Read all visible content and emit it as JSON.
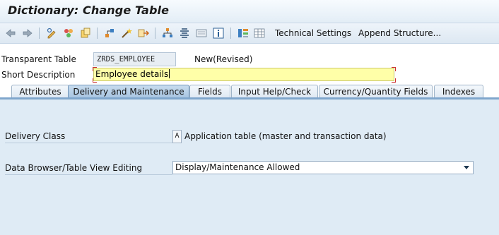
{
  "window": {
    "title": "Dictionary: Change Table"
  },
  "toolbar": {
    "icons": [
      "back-arrow-icon",
      "forward-arrow-icon",
      "display-change-icon",
      "activate-icon",
      "check-icon",
      "where-used-icon",
      "object-list-icon",
      "navigation-icon",
      "hierarchy-icon",
      "list-icon",
      "display-object-icon",
      "info-icon",
      "layout-icon",
      "table-icon"
    ],
    "technical_settings_label": "Technical Settings",
    "append_structure_label": "Append Structure..."
  },
  "header": {
    "transparent_table_label": "Transparent Table",
    "table_name": "ZRDS_EMPLOYEE",
    "status": "New(Revised)",
    "short_description_label": "Short Description",
    "short_description_value": "Employee details"
  },
  "tabs": [
    {
      "label": "Attributes",
      "active": false
    },
    {
      "label": "Delivery and Maintenance",
      "active": true
    },
    {
      "label": "Fields",
      "active": false
    },
    {
      "label": "Input Help/Check",
      "active": false
    },
    {
      "label": "Currency/Quantity Fields",
      "active": false
    },
    {
      "label": "Indexes",
      "active": false
    }
  ],
  "delivery": {
    "delivery_class_label": "Delivery Class",
    "delivery_class_value": "A",
    "delivery_class_description": "Application table (master and transaction data)",
    "data_browser_label": "Data Browser/Table View Editing",
    "data_browser_value": "Display/Maintenance Allowed"
  },
  "colors": {
    "background": "#dfebf5",
    "active_tab": "#a9c6e2",
    "input_required": "#ffffa8"
  }
}
